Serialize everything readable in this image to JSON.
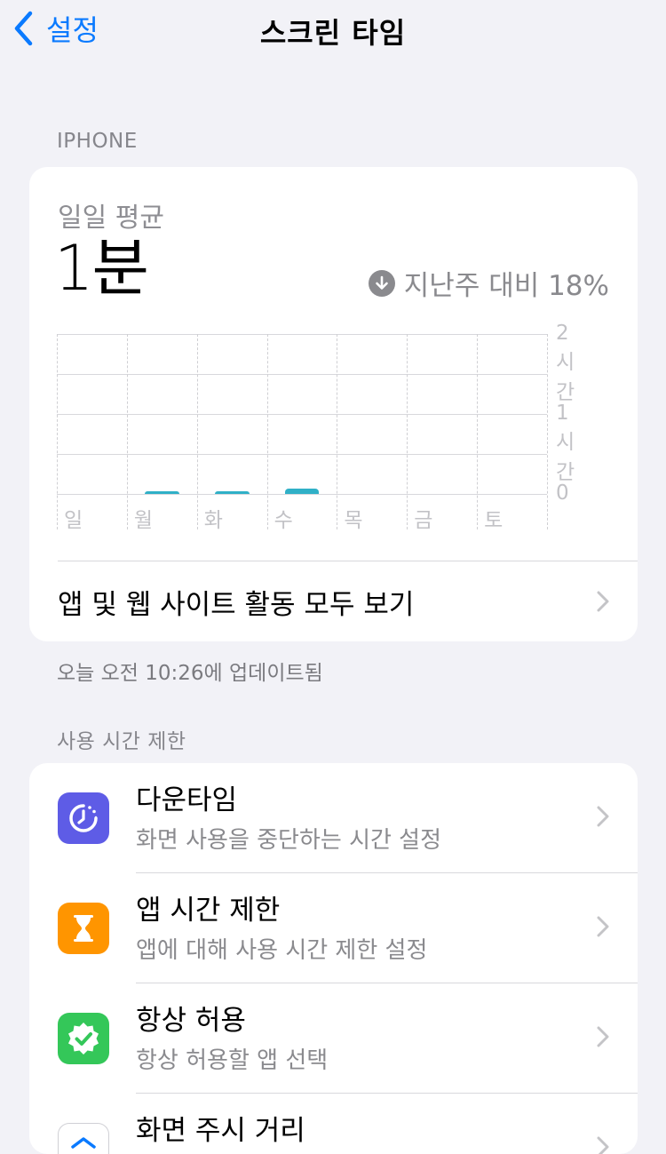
{
  "nav": {
    "back_label": "설정",
    "title": "스크린 타임"
  },
  "iphone_section": {
    "header": "IPHONE"
  },
  "summary": {
    "average_label": "일일 평균",
    "average_value": "1분",
    "compare_text": "지난주 대비 18%",
    "compare_direction": "down"
  },
  "chart_data": {
    "type": "bar",
    "categories": [
      "일",
      "월",
      "화",
      "수",
      "목",
      "금",
      "토"
    ],
    "values": [
      0,
      0.017,
      0.017,
      0.07,
      0,
      0,
      0
    ],
    "ylim": [
      0,
      2
    ],
    "y_ticks": [
      {
        "value": 2,
        "label": "2시간"
      },
      {
        "value": 1,
        "label": "1시간"
      },
      {
        "value": 0,
        "label": "0"
      }
    ],
    "bar_color": "#30b0c7",
    "grid": true
  },
  "all_activity_label": "앱 및 웹 사이트 활동 모두 보기",
  "updated_text": "오늘 오전 10:26에 업데이트됨",
  "limits_section": {
    "header": "사용 시간 제한",
    "items": [
      {
        "title": "다운타임",
        "subtitle": "화면 사용을 중단하는 시간 설정",
        "icon": "downtime-icon",
        "color": "#5e5ce6"
      },
      {
        "title": "앱 시간 제한",
        "subtitle": "앱에 대해 사용 시간 제한 설정",
        "icon": "hourglass-icon",
        "color": "#ff9500"
      },
      {
        "title": "항상 허용",
        "subtitle": "항상 허용할 앱 선택",
        "icon": "checkmark-seal-icon",
        "color": "#34c759"
      },
      {
        "title": "화면 주시 거리",
        "subtitle": "",
        "icon": "screen-distance-icon",
        "color": "#ffffff"
      }
    ]
  }
}
